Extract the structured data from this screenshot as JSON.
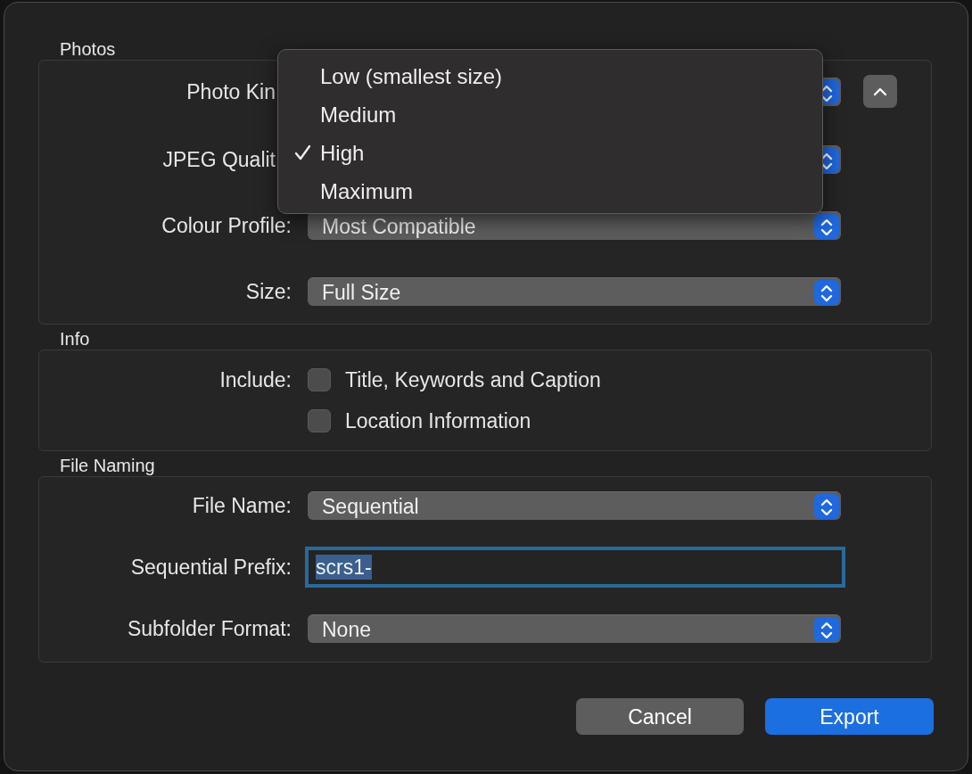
{
  "sections": [
    {
      "title": "Photos",
      "kind": "form",
      "rows": [
        {
          "kind": "select",
          "label": "Photo Kin",
          "expanded": true
        },
        {
          "kind": "select",
          "label": "JPEG Qualit"
        },
        {
          "kind": "select",
          "label": "Colour Profile:",
          "value": "Most Compatible"
        },
        {
          "kind": "select",
          "label": "Size:",
          "value": "Full Size"
        }
      ]
    },
    {
      "title": "Info",
      "kind": "form",
      "rows": [
        {
          "kind": "checks",
          "label": "Include:",
          "options": [
            {
              "label": "Title, Keywords and Caption",
              "checked": false
            },
            {
              "label": "Location Information",
              "checked": false
            }
          ]
        }
      ]
    },
    {
      "title": "File Naming",
      "kind": "form",
      "rows": [
        {
          "kind": "select",
          "label": "File Name:",
          "value": "Sequential"
        },
        {
          "kind": "text",
          "label": "Sequential Prefix:",
          "value": "scrs1-",
          "focused": true
        },
        {
          "kind": "select",
          "label": "Subfolder Format:",
          "value": "None"
        }
      ]
    }
  ],
  "menu": {
    "items": [
      {
        "label": "Low (smallest size)",
        "selected": false
      },
      {
        "label": "Medium",
        "selected": false
      },
      {
        "label": "High",
        "selected": true
      },
      {
        "label": "Maximum",
        "selected": false
      }
    ]
  },
  "buttons": [
    {
      "label": "Cancel",
      "kind": "secondary"
    },
    {
      "label": "Export",
      "kind": "primary"
    }
  ]
}
